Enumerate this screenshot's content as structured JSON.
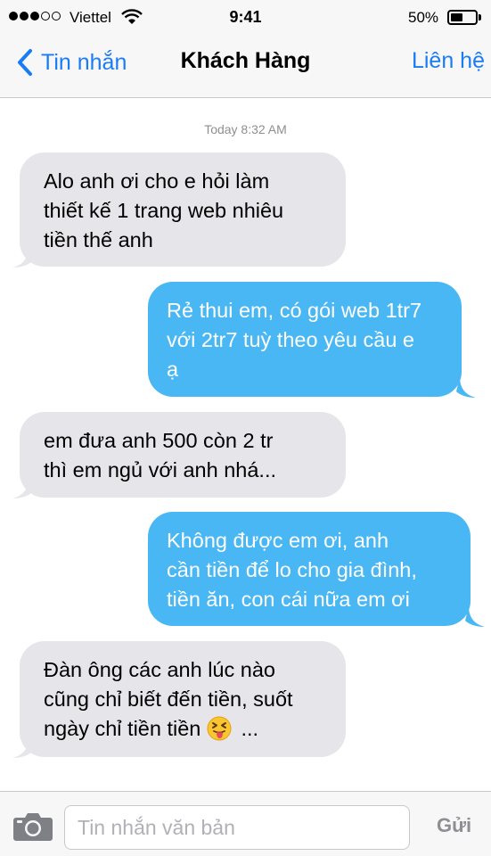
{
  "status_bar": {
    "carrier": "Viettel",
    "time": "9:41",
    "battery_percent": "50%",
    "battery_level": 0.5,
    "signal_bars_filled": 3,
    "signal_bars_total": 5,
    "icons": [
      "signal-dots-icon",
      "wifi-icon",
      "battery-icon"
    ]
  },
  "nav": {
    "back_label": "Tin nhắn",
    "title": "Khách Hàng",
    "contact_label": "Liên hệ",
    "accent_color": "#1a7cf5",
    "icons": [
      "chevron-left-icon"
    ]
  },
  "conversation": {
    "timestamp": "Today 8:32 AM",
    "received_color": "#e5e5ea",
    "sent_color": "#49b7f4",
    "messages": [
      {
        "direction": "received",
        "lines": [
          "Alo anh ơi cho e hỏi làm",
          "thiết kế 1 trang web nhiêu",
          "tiền thế anh"
        ]
      },
      {
        "direction": "sent",
        "lines": [
          "Rẻ thui em, có gói web 1tr7",
          "với 2tr7 tuỳ theo yêu cầu e",
          "ạ"
        ]
      },
      {
        "direction": "received",
        "lines": [
          "em đưa anh 500 còn 2 tr",
          "thì em ngủ với anh nhá..."
        ]
      },
      {
        "direction": "sent",
        "lines": [
          "Không được em ơi, anh",
          "cần tiền để lo cho gia đình,",
          "tiền ăn, con cái nữa em ơi"
        ]
      },
      {
        "direction": "received",
        "lines": [
          "Đàn ông các anh lúc nào",
          "cũng chỉ biết đến tiền, suốt",
          "ngày chỉ tiền tiền",
          " ..."
        ],
        "emoji": "tongue-out-face-icon"
      }
    ]
  },
  "input_bar": {
    "placeholder": "Tin nhắn văn bản",
    "value": "",
    "send_label": "Gửi",
    "icons": [
      "camera-icon"
    ]
  }
}
